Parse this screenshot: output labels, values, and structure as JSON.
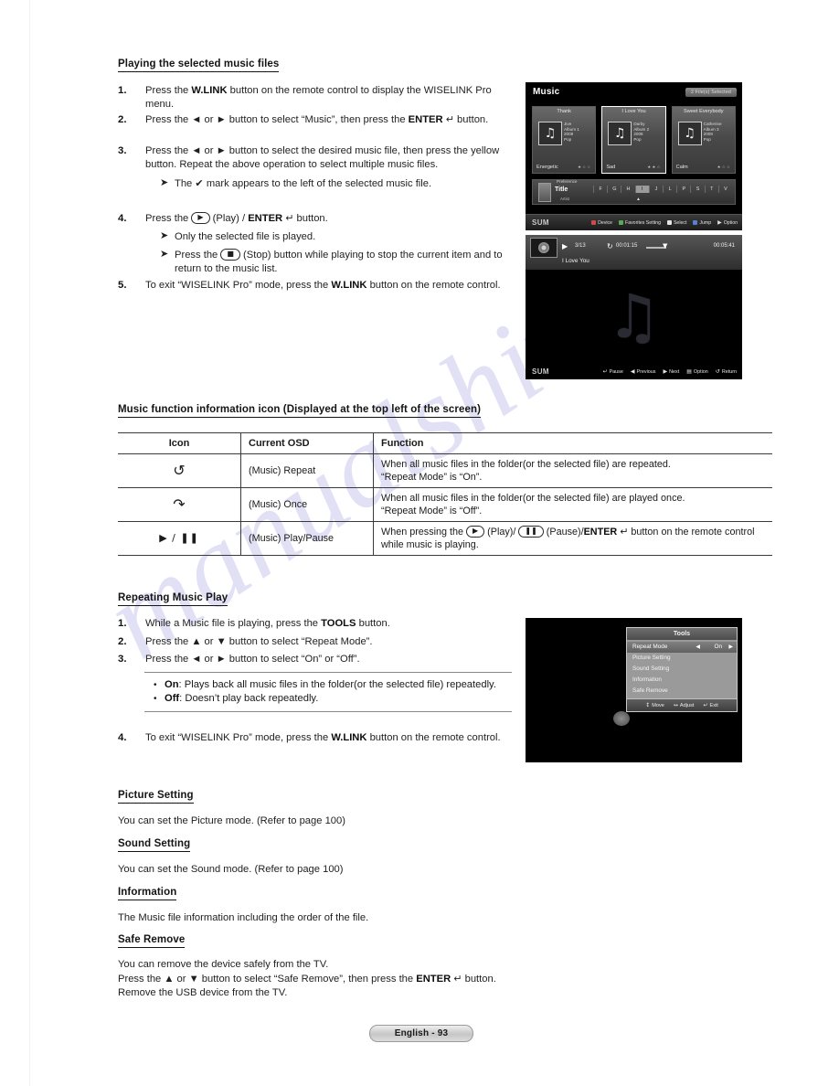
{
  "watermark": "manualshive.com",
  "footer": {
    "page_label": "English - 93"
  },
  "section1": {
    "heading": "Playing the selected music files",
    "steps": [
      {
        "num": "1.",
        "html": "Press the <b>W.LINK</b> button on the remote control to display the WISELINK Pro menu."
      },
      {
        "num": "2.",
        "html": "Press the ◄ or ► button to select “Music”, then press the <b>ENTER</b> <span class=\"enterglyph\">↵</span> button."
      },
      {
        "num": "3.",
        "html": "Press the ◄ or ► button to select the desired music file, then press the yellow button. Repeat the above operation to select multiple music files."
      },
      {
        "num": "4.",
        "html": "Press the <span class=\"key\">▶</span> (Play) / <b>ENTER</b> <span class=\"enterglyph\">↵</span> button."
      },
      {
        "num": "5.",
        "html": "To exit “WISELINK Pro” mode, press the <b>W.LINK</b> button on the remote control."
      }
    ],
    "sub_notes": [
      {
        "mark": "➤",
        "html": "The ✔ mark appears to the left of the selected music file."
      },
      {
        "mark": "➤",
        "html": "Only the selected file is played."
      },
      {
        "mark": "➤",
        "html": "Press the <span class=\"key\">■</span> (Stop) button while playing to stop the current item and to return to the music list."
      }
    ]
  },
  "table_section": {
    "heading": "Music function information icon (Displayed at the top left of the screen)",
    "columns": [
      "Icon",
      "Current OSD",
      "Function"
    ],
    "rows": [
      {
        "icon": "↺",
        "icon_name": "repeat-icon",
        "osd": "(Music) Repeat",
        "function_html": "When all music files in the folder(or the selected file) are repeated.<br>“Repeat Mode” is “On”."
      },
      {
        "icon": "↷",
        "icon_name": "once-icon",
        "osd": "(Music) Once",
        "function_html": "When all music files in the folder(or the selected file) are played once.<br>“Repeat Mode” is “Off”."
      },
      {
        "icon": "▶ / ❚❚",
        "icon_name": "play-pause-icon",
        "osd": "(Music) Play/Pause",
        "function_html": "When pressing the <span class=\"key\">▶</span> (Play)/ <span class=\"key\">❚❚</span> (Pause)/<b>ENTER</b> <span class=\"enterglyph\">↵</span> button on the remote control while music is playing."
      }
    ]
  },
  "section2": {
    "heading": "Repeating Music Play",
    "steps": [
      {
        "num": "1.",
        "html": "While a Music file is playing, press the <b>TOOLS</b> button."
      },
      {
        "num": "2.",
        "html": "Press the ▲ or ▼ button to select “Repeat Mode”."
      },
      {
        "num": "3.",
        "html": "Press the ◄ or ► button to select “On” or “Off”."
      },
      {
        "num": "4.",
        "html": "To exit “WISELINK Pro” mode, press the <b>W.LINK</b> button on the remote control."
      }
    ],
    "notes": [
      {
        "dot": "•",
        "html": "<b>On</b>: Plays back all music files in the folder(or the selected file) repeatedly."
      },
      {
        "dot": "•",
        "html": "<b>Off</b>: Doesn’t play back repeatedly."
      }
    ]
  },
  "section3": {
    "items": [
      {
        "heading": "Picture Setting",
        "body_html": "You can set the Picture mode. (Refer to page 100)"
      },
      {
        "heading": "Sound Setting",
        "body_html": "You can set the Sound mode. (Refer to page 100)"
      },
      {
        "heading": "Information",
        "body_html": "The Music file information including the order of the file."
      },
      {
        "heading": "Safe Remove",
        "body_html": "You can remove the device safely from the TV.<br>Press the ▲ or ▼ button to select “Safe Remove”, then press the <b>ENTER</b> <span class=\"enterglyph\">↵</span> button.<br>Remove the USB device from the TV."
      }
    ]
  },
  "tv_music_screen": {
    "title": "Music",
    "badge": "2 File(s) Selected",
    "cards": [
      {
        "title": "Thank",
        "track": "Jive",
        "album": "Album 1",
        "year": "2008",
        "genre": "Pop",
        "mood": "Energetic",
        "stars": "★☆☆",
        "selected": false
      },
      {
        "title": "I Love You",
        "track": "Darby",
        "album": "Album 2",
        "year": "2008",
        "genre": "Pop",
        "mood": "Sad",
        "stars": "★★☆",
        "selected": true
      },
      {
        "title": "Sweet Everybody",
        "track": "Catherine",
        "album": "Album 3",
        "year": "2008",
        "genre": "Pop",
        "mood": "Calm",
        "stars": "★☆☆",
        "selected": false
      }
    ],
    "sort": {
      "preference_label": "Preference",
      "current": "Title",
      "artist_label": "Artist"
    },
    "alphabet": [
      "F",
      "G",
      "H",
      "I",
      "J",
      "L",
      "P",
      "S",
      "T",
      "V"
    ],
    "alphabet_selected": "I",
    "footer_left": "SUM",
    "footer_keys": [
      {
        "swatch": "red",
        "label": "Device"
      },
      {
        "swatch": "green",
        "label": "Favorites Setting"
      },
      {
        "swatch": "white",
        "label": "Select"
      },
      {
        "swatch": "blue",
        "label": "Jump"
      },
      {
        "swatch": "none",
        "label": "Option"
      }
    ]
  },
  "tv_player_screen": {
    "track_index": "3/13",
    "elapsed": "00:01:15",
    "total": "00:05:41",
    "song_title": "I Love You",
    "footer_left": "SUM",
    "footer_keys": [
      "Pause",
      "Previous",
      "Next",
      "Option",
      "Return"
    ]
  },
  "tv_tools_screen": {
    "panel_title": "Tools",
    "items": [
      {
        "label": "Repeat Mode",
        "value": "On",
        "selected": true
      },
      {
        "label": "Picture Setting",
        "value": "",
        "selected": false
      },
      {
        "label": "Sound Setting",
        "value": "",
        "selected": false
      },
      {
        "label": "Information",
        "value": "",
        "selected": false
      },
      {
        "label": "Safe Remove",
        "value": "",
        "selected": false
      }
    ],
    "footer_keys": [
      {
        "glyph": "↕",
        "label": "Move"
      },
      {
        "glyph": "↔",
        "label": "Adjust"
      },
      {
        "glyph": "↵",
        "label": "Exit"
      }
    ]
  }
}
